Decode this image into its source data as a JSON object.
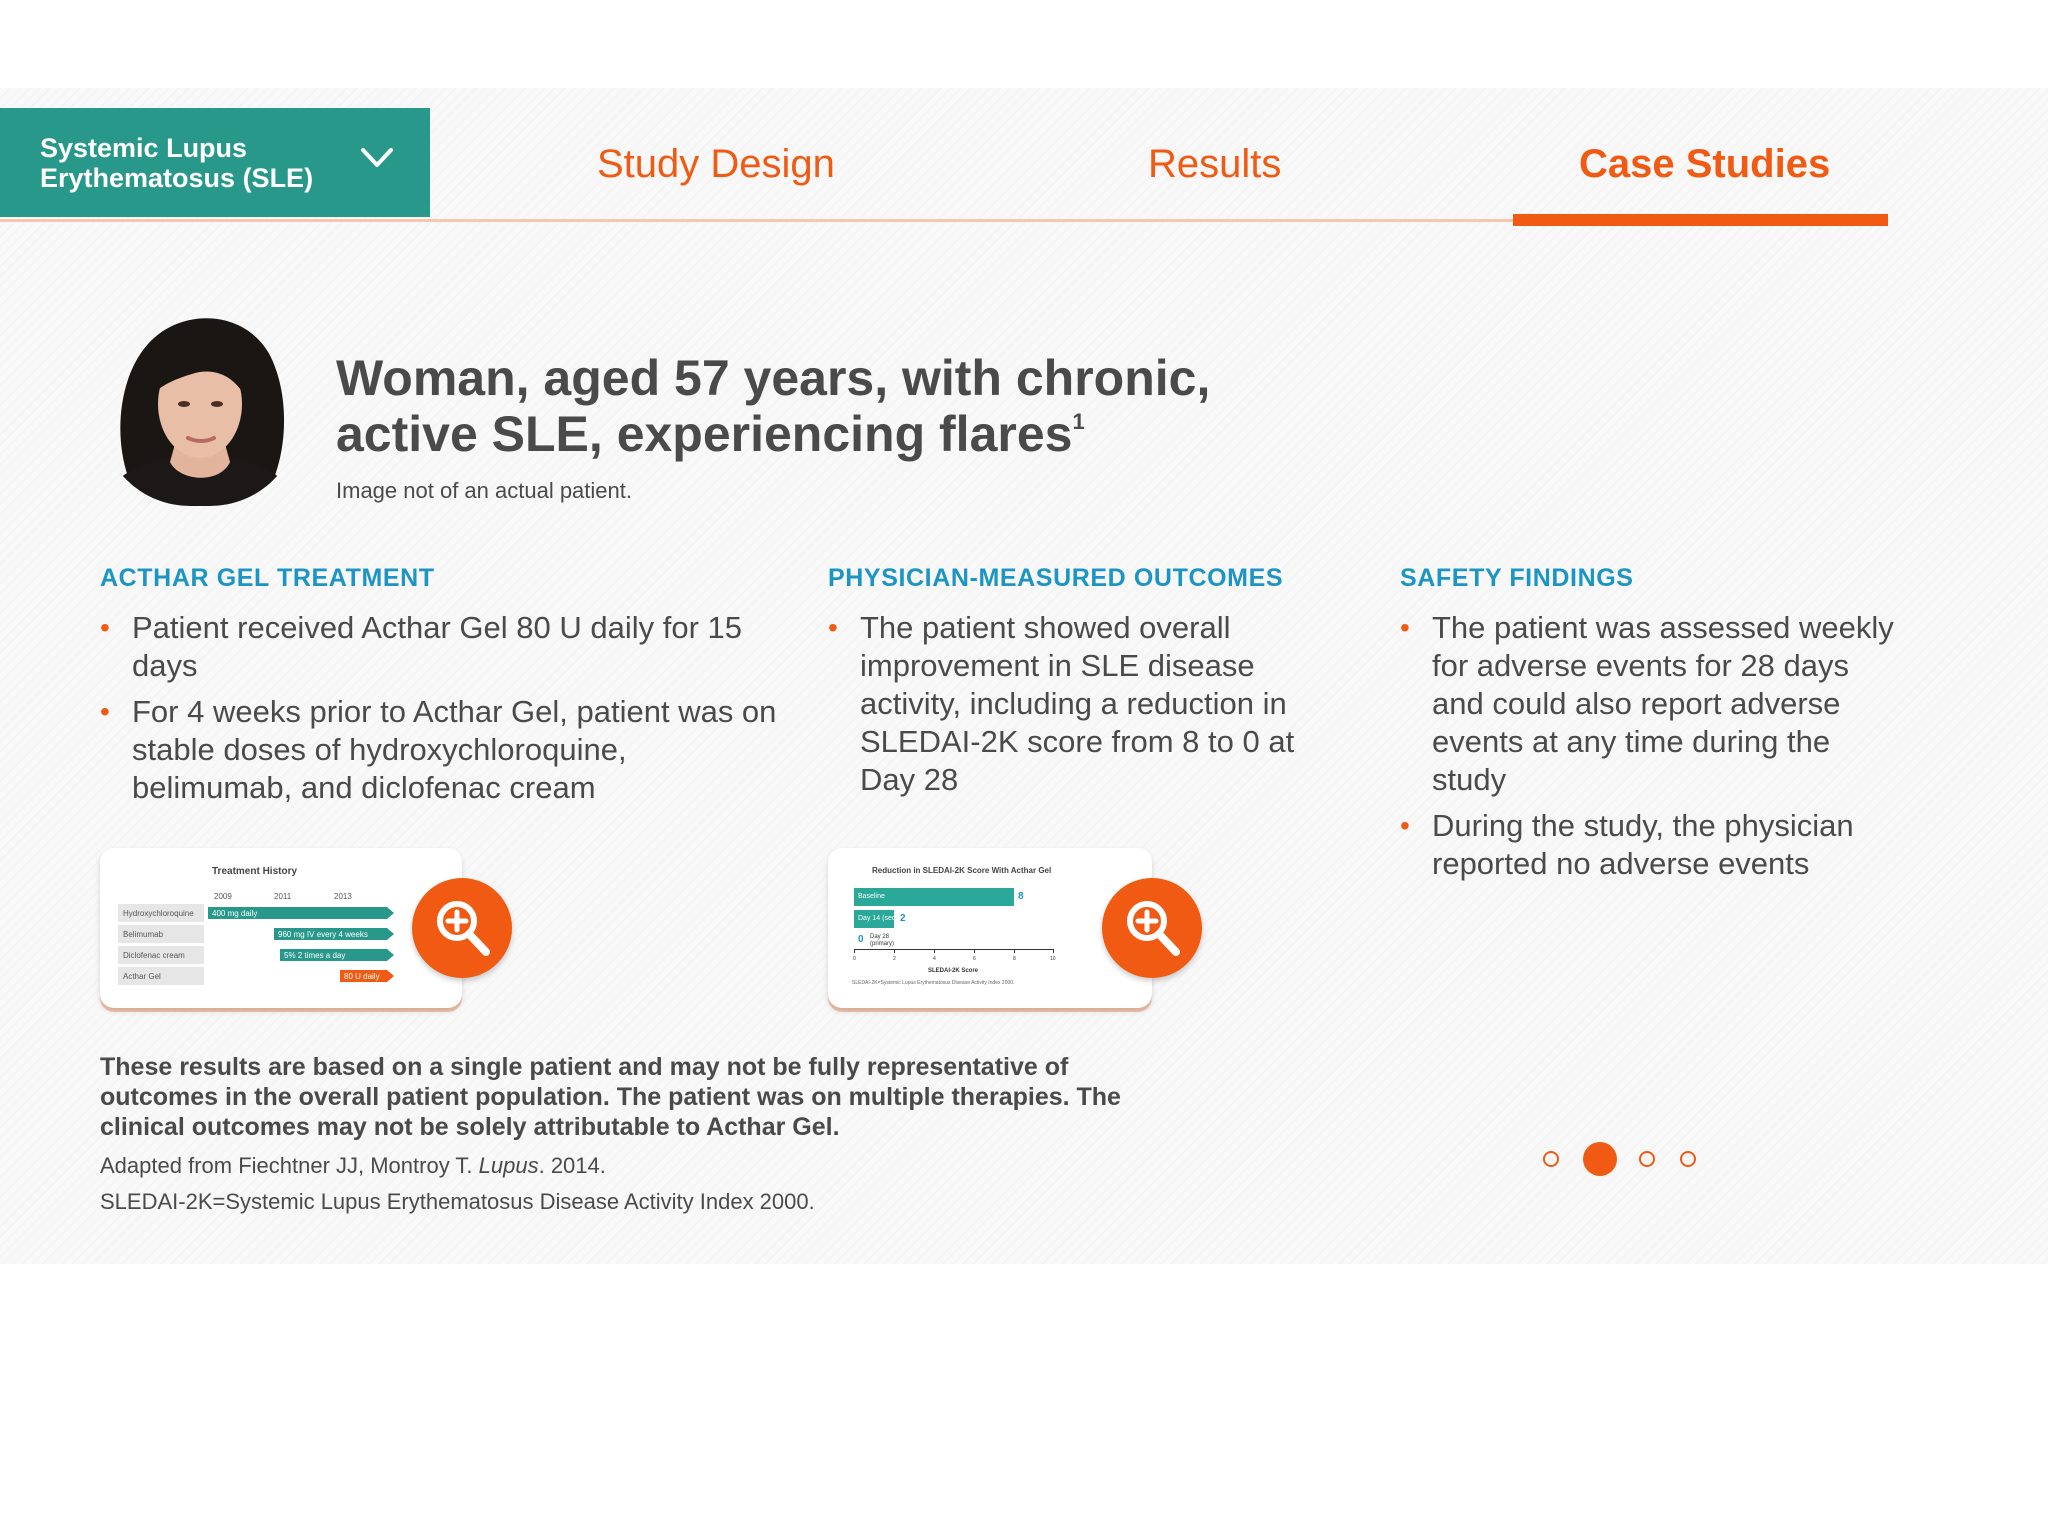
{
  "topic_selector": {
    "label": "Systemic Lupus\nErythematosus (SLE)",
    "icon": "chevron-down-icon"
  },
  "tabs": [
    {
      "label": "Study Design",
      "active": false
    },
    {
      "label": "Results",
      "active": false
    },
    {
      "label": "Case Studies",
      "active": true
    }
  ],
  "case": {
    "title": "Woman, aged 57 years, with chronic, active SLE, experiencing flares",
    "title_sup": "1",
    "image_note": "Image not of an actual patient."
  },
  "columns": [
    {
      "heading": "ACTHAR GEL TREATMENT",
      "bullets": [
        "Patient received Acthar Gel 80 U daily for 15 days",
        "For 4 weeks prior to Acthar Gel, patient was on stable doses of hydroxychloroquine, belimumab, and diclofenac cream"
      ]
    },
    {
      "heading": "PHYSICIAN-MEASURED OUTCOMES",
      "bullets": [
        "The patient showed overall improvement in SLE disease activity, including a reduction in SLEDAI-2K score from 8 to 0 at Day 28"
      ]
    },
    {
      "heading": "SAFETY FINDINGS",
      "bullets": [
        "The patient was assessed weekly for adverse events for 28 days and could also report adverse events at any time during the study",
        "During the study, the physician reported no adverse events"
      ]
    }
  ],
  "treatment_history_thumb": {
    "title": "Treatment History",
    "years": [
      "2009",
      "2011",
      "2013"
    ],
    "rows": [
      {
        "drug": "Hydroxychloroquine",
        "regimen": "400 mg daily"
      },
      {
        "drug": "Belimumab",
        "regimen": "960 mg IV every 4 weeks"
      },
      {
        "drug": "Diclofenac cream",
        "regimen": "5% 2 times a day"
      },
      {
        "drug": "Acthar Gel",
        "regimen": "80 U daily"
      }
    ]
  },
  "sledai_thumb": {
    "title": "Reduction in SLEDAI-2K Score With Acthar Gel",
    "bars": [
      {
        "label": "Baseline",
        "value": "8"
      },
      {
        "label": "Day 14 (secondary)",
        "value": "2"
      },
      {
        "label": "Day 28 (primary)",
        "value": "0"
      }
    ],
    "ticks": [
      "0",
      "2",
      "4",
      "6",
      "8",
      "10"
    ],
    "xlabel": "SLEDAI-2K Score",
    "footnote": "SLEDAI-2K=Systemic Lupus Erythematosus Disease Activity Index 2000."
  },
  "footer": {
    "bold_note": "These results are based on a single patient and may not be fully representative of outcomes in the overall patient population. The patient was on multiple therapies. The clinical outcomes may not be solely attributable to Acthar Gel.",
    "ref_prefix": "Adapted from Fiechtner JJ, Montroy T. ",
    "ref_journal": "Lupus",
    "ref_suffix": ". 2014.",
    "abbrev": "SLEDAI-2K=Systemic Lupus Erythematosus Disease Activity Index 2000."
  },
  "pager": {
    "total": 4,
    "active_index": 1
  },
  "colors": {
    "teal": "#28988a",
    "orange": "#f05a12",
    "heading_blue": "#1d95c4",
    "text": "#4a4a4a"
  }
}
